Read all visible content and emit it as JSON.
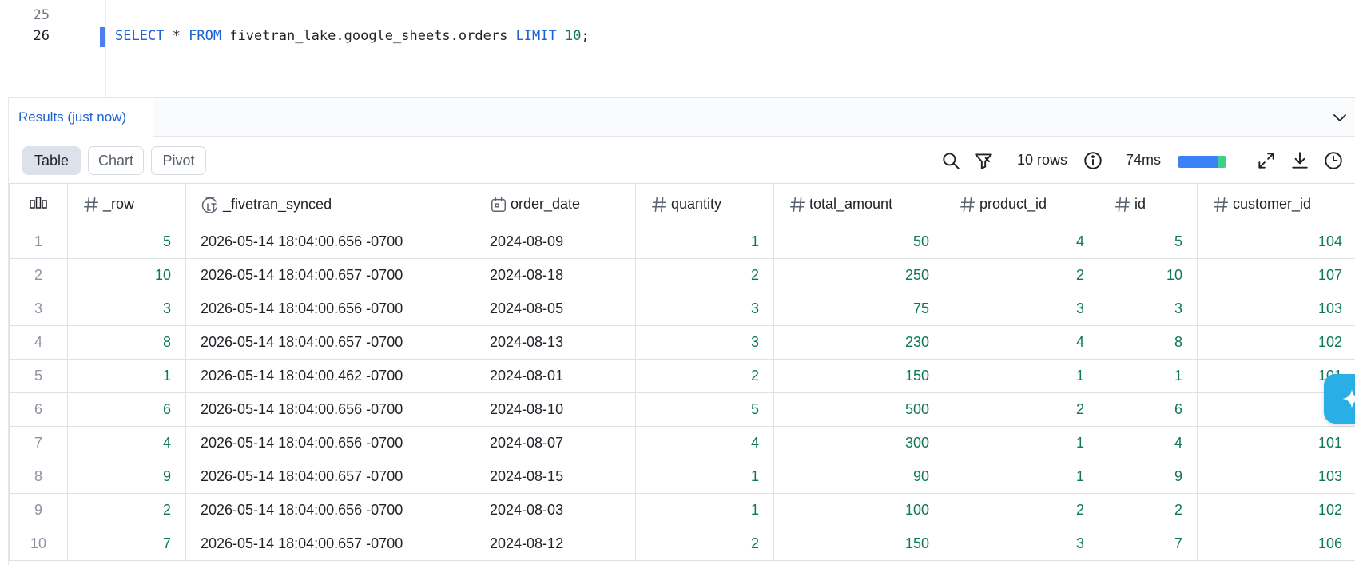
{
  "editor": {
    "lines": [
      {
        "number": "25",
        "code": ""
      },
      {
        "number": "26",
        "code": "SELECT * FROM fivetran_lake.google_sheets.orders LIMIT 10;"
      }
    ],
    "tokens": {
      "select": "SELECT",
      "star": " * ",
      "from": "FROM",
      "table": " fivetran_lake.google_sheets.orders ",
      "limit": "LIMIT",
      "space": " ",
      "limit_value": "10",
      "semicolon": ";"
    }
  },
  "results": {
    "tab_label": "Results (just now)",
    "collapse_icon": "chevron-down-icon",
    "view_modes": [
      "Table",
      "Chart",
      "Pivot"
    ],
    "active_view": "Table",
    "row_count_label": "10 rows",
    "duration_label": "74ms",
    "perf_fraction": 0.84,
    "accent_color": "#1a62d6",
    "perf_colors": {
      "main": "#3b82f6",
      "tail": "#3ccf8e"
    }
  },
  "table": {
    "columns": [
      {
        "name": "_row",
        "icon": "hash-icon"
      },
      {
        "name": "_fivetran_synced",
        "icon": "timestamp-icon"
      },
      {
        "name": "order_date",
        "icon": "calendar-icon"
      },
      {
        "name": "quantity",
        "icon": "hash-icon"
      },
      {
        "name": "total_amount",
        "icon": "hash-icon"
      },
      {
        "name": "product_id",
        "icon": "hash-icon"
      },
      {
        "name": "id",
        "icon": "hash-icon"
      },
      {
        "name": "customer_id",
        "icon": "hash-icon"
      }
    ],
    "rows": [
      [
        "1",
        "5",
        "2026-05-14 18:04:00.656 -0700",
        "2024-08-09",
        "1",
        "50",
        "4",
        "5",
        "104"
      ],
      [
        "2",
        "10",
        "2026-05-14 18:04:00.657 -0700",
        "2024-08-18",
        "2",
        "250",
        "2",
        "10",
        "107"
      ],
      [
        "3",
        "3",
        "2026-05-14 18:04:00.656 -0700",
        "2024-08-05",
        "3",
        "75",
        "3",
        "3",
        "103"
      ],
      [
        "4",
        "8",
        "2026-05-14 18:04:00.657 -0700",
        "2024-08-13",
        "3",
        "230",
        "4",
        "8",
        "102"
      ],
      [
        "5",
        "1",
        "2026-05-14 18:04:00.462 -0700",
        "2024-08-01",
        "2",
        "150",
        "1",
        "1",
        "101"
      ],
      [
        "6",
        "6",
        "2026-05-14 18:04:00.656 -0700",
        "2024-08-10",
        "5",
        "500",
        "2",
        "6",
        "1"
      ],
      [
        "7",
        "4",
        "2026-05-14 18:04:00.656 -0700",
        "2024-08-07",
        "4",
        "300",
        "1",
        "4",
        "101"
      ],
      [
        "8",
        "9",
        "2026-05-14 18:04:00.657 -0700",
        "2024-08-15",
        "1",
        "90",
        "1",
        "9",
        "103"
      ],
      [
        "9",
        "2",
        "2026-05-14 18:04:00.656 -0700",
        "2024-08-03",
        "1",
        "100",
        "2",
        "2",
        "102"
      ],
      [
        "10",
        "7",
        "2026-05-14 18:04:00.657 -0700",
        "2024-08-12",
        "2",
        "150",
        "3",
        "7",
        "106"
      ]
    ]
  }
}
